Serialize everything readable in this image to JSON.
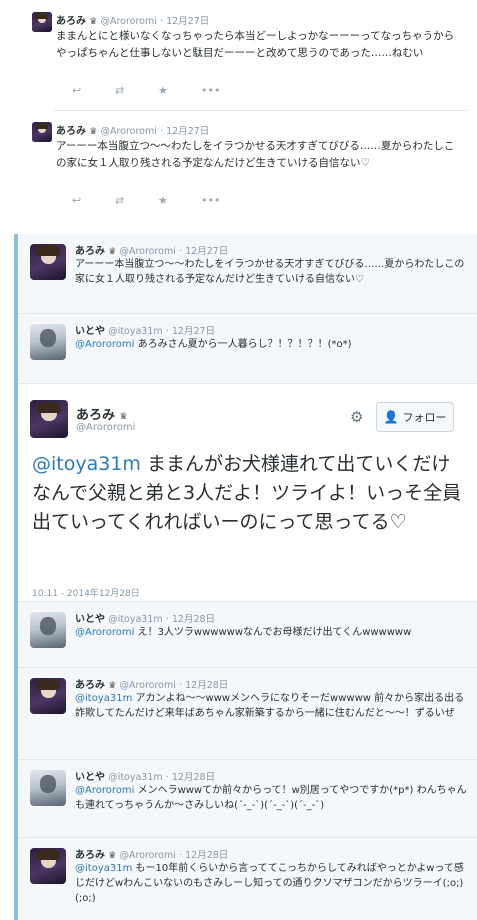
{
  "top_tweets": [
    {
      "name": "あろみ",
      "crown": "♛",
      "handle": "@Arororomi",
      "date": "· 12月27日",
      "text": "ままんとにと様いなくなっちゃったら本当どーしよっかなーーーってなっちゃうからやっぱちゃんと仕事しないと駄目だーーーと改めて思うのであった……ねむい"
    },
    {
      "name": "あろみ",
      "crown": "♛",
      "handle": "@Arororomi",
      "date": "· 12月27日",
      "text": "アーーー本当腹立つ〜〜わたしをイラつかせる天才すぎてびびる……夏からわたしこの家に女１人取り残される予定なんだけど生きていける自信ない♡"
    }
  ],
  "actions": {
    "reply": "↩",
    "retweet": "⇄",
    "favorite": "★",
    "more": "•••"
  },
  "replies_before": [
    {
      "name": "あろみ",
      "crown": "♛",
      "handle": "@Arororomi",
      "date": "· 12月27日",
      "mention": "",
      "text": "アーーー本当腹立つ〜〜わたしをイラつかせる天才すぎてびびる……夏からわたしこの家に女１人取り残される予定なんだけど生きていける自信ない♡"
    },
    {
      "name": "いとや",
      "crown": "",
      "handle": "@itoya31m",
      "date": "· 12月27日",
      "mention": "@Arororomi",
      "text": " あろみさん夏から一人暮らし？！？！？！(*o*)"
    }
  ],
  "main_tweet": {
    "name": "あろみ",
    "crown": "♛",
    "handle": "@Arororomi",
    "follow_label": "フォロー",
    "mention": "@itoya31m",
    "text": " ままんがお犬様連れて出ていくだけなんで父親と弟と3人だよ！ツライよ！いっそ全員出ていってくれればいーのにって思ってる♡",
    "timestamp": "10:11 - 2014年12月28日"
  },
  "replies_after": [
    {
      "name": "いとや",
      "crown": "",
      "handle": "@itoya31m",
      "date": "· 12月28日",
      "mention": "@Arororomi",
      "text": " え！3人ツラwwwwwwなんでお母様だけ出てくんwwwwww"
    },
    {
      "name": "あろみ",
      "crown": "♛",
      "handle": "@Arororomi",
      "date": "· 12月28日",
      "mention": "@itoya31m",
      "text": " アカンよね〜〜wwwメンヘラになりそーだwwwww 前々から家出る出る詐欺してたんだけど来年ばあちゃん家新築するから一緒に住むんだと〜〜！ずるいぜ"
    },
    {
      "name": "いとや",
      "crown": "",
      "handle": "@itoya31m",
      "date": "· 12月28日",
      "mention": "@Arororomi",
      "text": " メンヘラwwwてか前々からって！w別居ってやつですか(*p*) わんちゃんも連れてっちゃうんか〜さみしいね(´-_-`)(´-_-`)(´-_-`)"
    },
    {
      "name": "あろみ",
      "crown": "♛",
      "handle": "@Arororomi",
      "date": "· 12月28日",
      "mention": "@itoya31m",
      "text": " もー10年前くらいから言っててこっちからしてみればやっとかよwって感じだけどwわんこいないのもさみしーし知っての通りクソマザコンだからツラーイ(;o;)(;o;)"
    }
  ],
  "colors": {
    "link": "#2b7bb9",
    "muted": "#8899a6",
    "background_reply": "#f5f8fa",
    "accent_edge": "#8fbfe0"
  }
}
